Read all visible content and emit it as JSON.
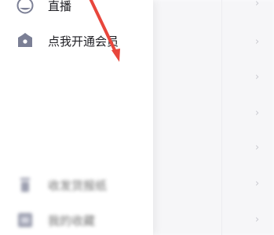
{
  "drawer": {
    "items": [
      {
        "label": "直播",
        "icon": "live-icon"
      },
      {
        "label": "点我开通会员",
        "icon": "vip-crown-icon"
      },
      {
        "label": "收发货报纸",
        "icon": "trash-icon"
      },
      {
        "label": "我的收藏",
        "icon": "collection-icon"
      }
    ]
  },
  "colors": {
    "annotation_red": "#e8463c",
    "icon_gray": "#7b7f95",
    "text": "#1f1f24"
  }
}
